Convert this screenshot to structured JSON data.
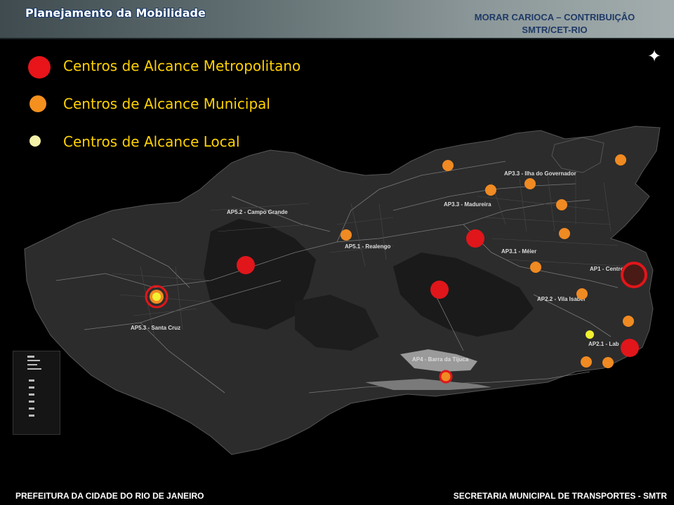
{
  "header": {
    "title": "Planejamento da Mobilidade",
    "right_line1": "MORAR CARIOCA – CONTRIBUIÇÂO",
    "right_line2": "SMTR/CET-RIO"
  },
  "legend": {
    "items": [
      {
        "label": "Centros de Alcance Metropolitano",
        "color": "#e8141a"
      },
      {
        "label": "Centros de Alcance Municipal",
        "color": "#f5901e"
      },
      {
        "label": "Centros de Alcance Local",
        "color": "#f4f1a8"
      }
    ]
  },
  "map": {
    "regions": [
      {
        "label": "AP3.3 - Ilha do Governador"
      },
      {
        "label": "AP3.3 - Madureira"
      },
      {
        "label": "AP5.2 - Campo Grande"
      },
      {
        "label": "AP5.1 - Realengo"
      },
      {
        "label": "AP3.1 - Méier"
      },
      {
        "label": "AP1 - Centro"
      },
      {
        "label": "AP2.2 - Vila Isabel"
      },
      {
        "label": "AP5.3 - Santa Cruz"
      },
      {
        "label": "AP2.1 - Lab"
      },
      {
        "label": "AP4 - Barra da Tijuca"
      }
    ],
    "compass_icon": "compass-rose-icon"
  },
  "footer": {
    "left": "PREFEITURA DA CIDADE DO RIO DE JANEIRO",
    "right": "SECRETARIA MUNICIPAL DE TRANSPORTES - SMTR"
  }
}
